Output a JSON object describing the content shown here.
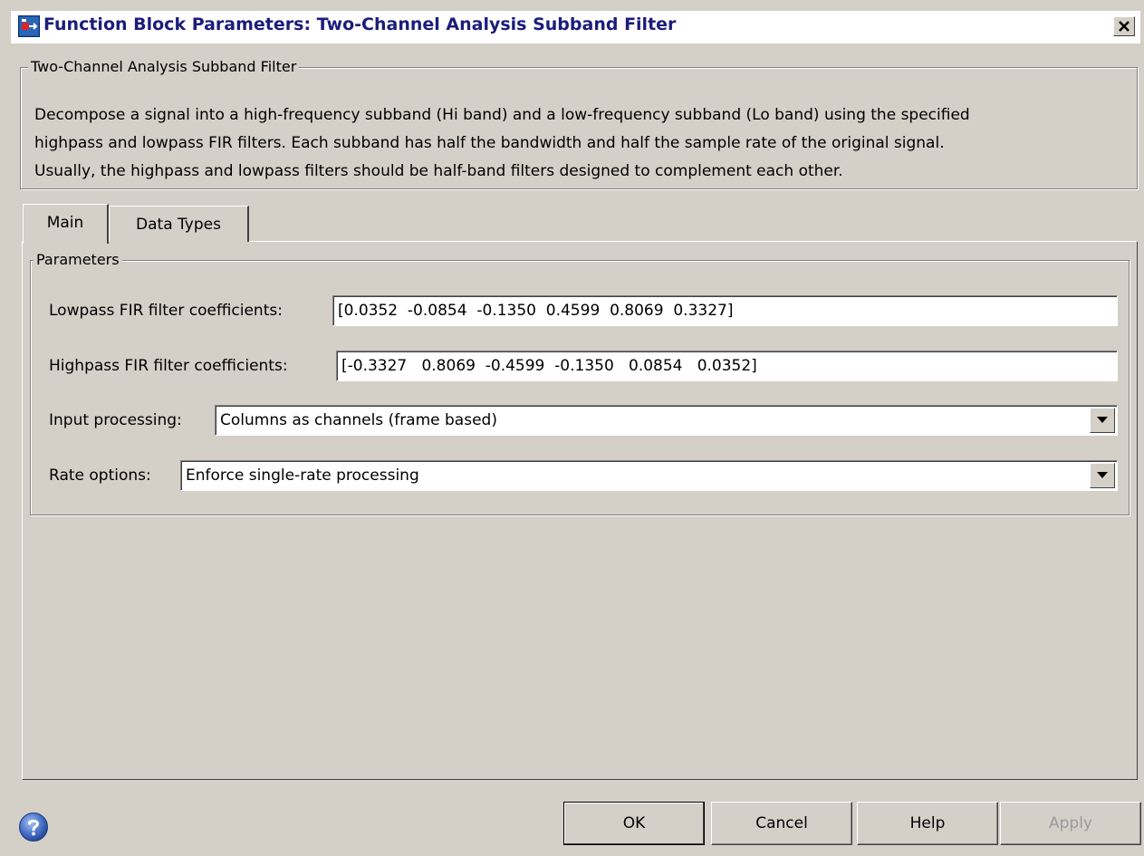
{
  "window": {
    "title": "Function Block Parameters: Two-Channel Analysis Subband Filter"
  },
  "description": {
    "group_title": "Two-Channel Analysis Subband Filter",
    "text": "Decompose a signal into a high-frequency subband (Hi band) and a low-frequency subband (Lo band) using the specified\nhighpass and lowpass FIR filters.  Each subband has half the bandwidth and half the sample rate of the original signal.\nUsually, the highpass and lowpass filters should be half-band filters designed to complement each other."
  },
  "tabs": [
    {
      "label": "Main",
      "selected": true
    },
    {
      "label": "Data Types",
      "selected": false
    }
  ],
  "parameters": {
    "group_title": "Parameters",
    "lowpass": {
      "label": "Lowpass FIR filter coefficients:",
      "value": "[0.0352  -0.0854  -0.1350  0.4599  0.8069  0.3327]"
    },
    "highpass": {
      "label": "Highpass FIR filter coefficients:",
      "value": "[-0.3327   0.8069  -0.4599  -0.1350   0.0854   0.0352]"
    },
    "input_processing": {
      "label": "Input processing:",
      "selected": "Columns as channels (frame based)"
    },
    "rate_options": {
      "label": "Rate options:",
      "selected": "Enforce single-rate processing"
    }
  },
  "buttons": {
    "ok": "OK",
    "cancel": "Cancel",
    "help": "Help",
    "apply": "Apply",
    "apply_enabled": false
  },
  "icons": {
    "title_icon": "simulink-block-icon",
    "close": "close-icon",
    "help": "help-circle-icon",
    "dropdown": "chevron-down-icon"
  },
  "colors": {
    "background": "#d4d0c8",
    "title_text": "#1c1c7a",
    "help_icon": "#3b63b8"
  }
}
